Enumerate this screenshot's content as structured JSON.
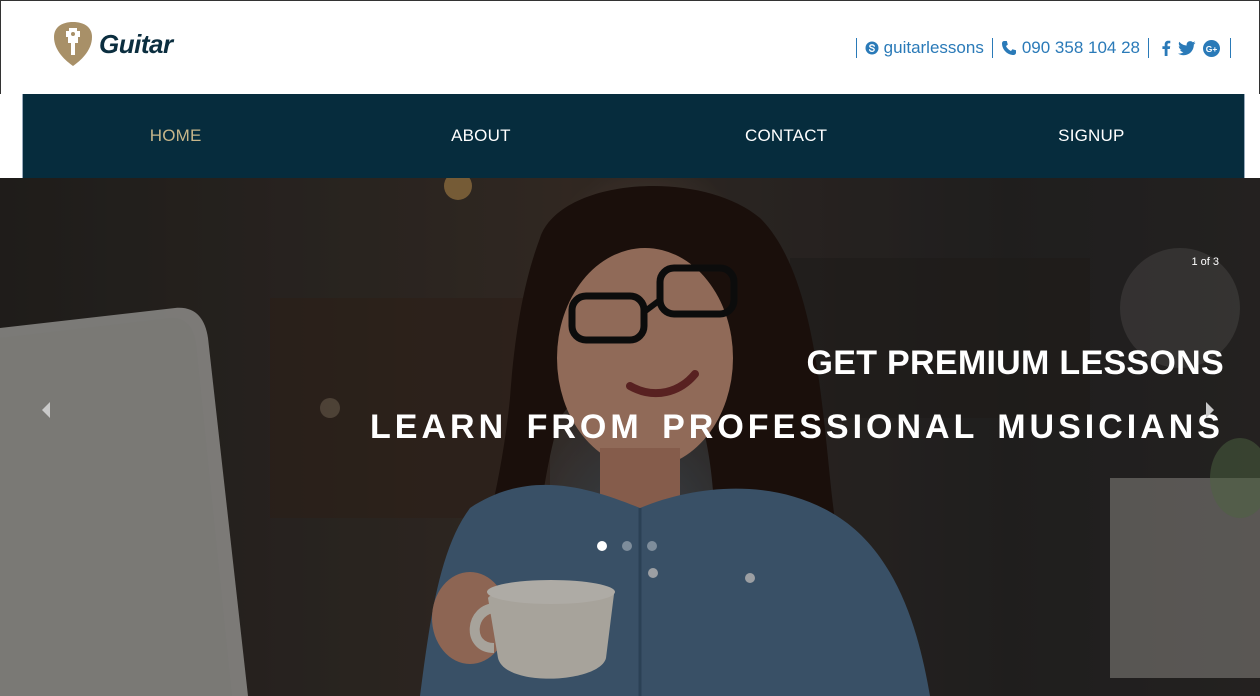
{
  "brand": {
    "name": "Guitar"
  },
  "contact": {
    "skype": "guitarlessons",
    "phone": "090 358 104 28",
    "social": [
      "facebook-icon",
      "twitter-icon",
      "google-plus-icon"
    ]
  },
  "nav": {
    "items": [
      {
        "label": "HOME",
        "active": true
      },
      {
        "label": "ABOUT",
        "active": false
      },
      {
        "label": "CONTACT",
        "active": false
      },
      {
        "label": "SIGNUP",
        "active": false
      }
    ]
  },
  "slider": {
    "counter": "1 of 3",
    "headline": "GET PREMIUM LESSONS",
    "subline": "LEARN FROM PROFESSIONAL MUSICIANS",
    "current_slide": 1,
    "total_slides": 3
  },
  "colors": {
    "nav_bg": "#062c3d",
    "nav_active": "#c7b68a",
    "link_blue": "#2a7ab8",
    "logo_gold": "#a89068",
    "logo_text": "#0b2e3f"
  }
}
